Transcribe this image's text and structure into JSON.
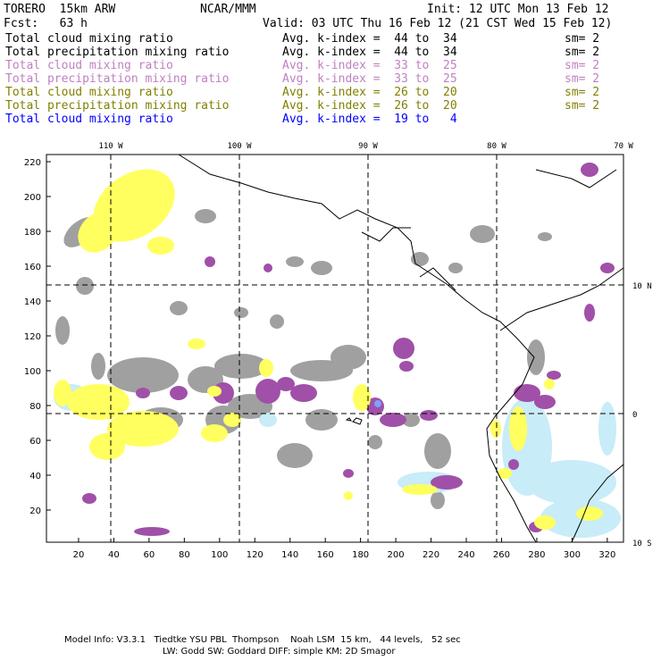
{
  "header": {
    "model": "TORERO  15km ARW",
    "org": "NCAR/MMM",
    "init": "Init: 12 UTC Mon 13 Feb 12",
    "fcst": "Fcst:   63 h",
    "valid": "Valid: 03 UTC Thu 16 Feb 12 (21 CST Wed 15 Feb 12)"
  },
  "legend": [
    {
      "field": "Total cloud mixing ratio",
      "range": "Avg. k-index =  44 to  34",
      "sm": "sm= 2",
      "color": "#000000"
    },
    {
      "field": "Total precipitation mixing ratio",
      "range": "Avg. k-index =  44 to  34",
      "sm": "sm= 2",
      "color": "#000000"
    },
    {
      "field": "Total cloud mixing ratio",
      "range": "Avg. k-index =  33 to  25",
      "sm": "sm= 2",
      "color": "#c080c0"
    },
    {
      "field": "Total precipitation mixing ratio",
      "range": "Avg. k-index =  33 to  25",
      "sm": "sm= 2",
      "color": "#c080c0"
    },
    {
      "field": "Total cloud mixing ratio",
      "range": "Avg. k-index =  26 to  20",
      "sm": "sm= 2",
      "color": "#808000"
    },
    {
      "field": "Total precipitation mixing ratio",
      "range": "Avg. k-index =  26 to  20",
      "sm": "sm= 2",
      "color": "#808000"
    },
    {
      "field": "Total cloud mixing ratio",
      "range": "Avg. k-index =  19 to   4",
      "sm": "",
      "color": "#0000ff"
    }
  ],
  "map": {
    "lon_labels": [
      "110 W",
      "100 W",
      "90 W",
      "80 W",
      "70 W"
    ],
    "lat_labels": [
      "10 N",
      "0",
      "10 S"
    ],
    "x_ticks": [
      "20",
      "40",
      "60",
      "80",
      "100",
      "120",
      "140",
      "160",
      "180",
      "200",
      "220",
      "240",
      "260",
      "280",
      "300",
      "320"
    ],
    "y_ticks": [
      "20",
      "40",
      "60",
      "80",
      "100",
      "120",
      "140",
      "160",
      "180",
      "200",
      "220"
    ],
    "fill_colors": {
      "high": "#a0a0a0",
      "mid": "#a050a8",
      "low": "#ffff60",
      "lowest": "#c8ecf8"
    }
  },
  "footer": {
    "line1": "Model Info: V3.3.1   Tiedtke YSU PBL  Thompson    Noah LSM  15 km,   44 levels,   52 sec",
    "line2": "LW: Godd SW: Goddard DIFF: simple KM: 2D Smagor"
  }
}
